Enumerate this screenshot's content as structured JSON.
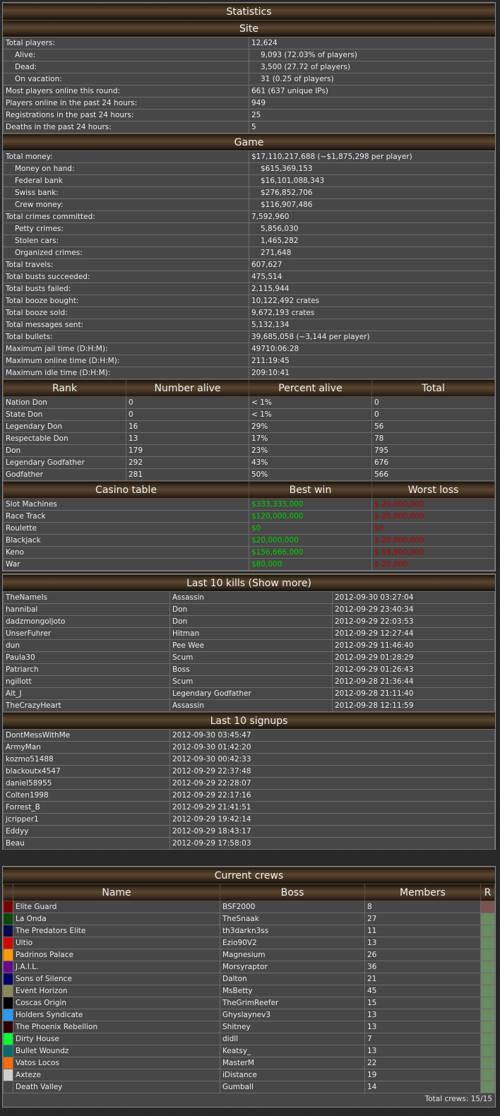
{
  "titles": {
    "statistics": "Statistics",
    "site": "Site",
    "game": "Game",
    "kills": "Last 10 kills (Show more)",
    "signups": "Last 10 signups",
    "crews": "Current crews"
  },
  "site": [
    {
      "label": "Total players:",
      "value": "12,624",
      "indent": false
    },
    {
      "label": "Alive:",
      "value": "9,093 (72.03% of players)",
      "indent": true
    },
    {
      "label": "Dead:",
      "value": "3,500 (27.72 of players)",
      "indent": true
    },
    {
      "label": "On vacation:",
      "value": "31 (0.25 of players)",
      "indent": true
    },
    {
      "label": "Most players online this round:",
      "value": "661 (637 unique IPs)",
      "indent": false
    },
    {
      "label": "Players online in the past 24 hours:",
      "value": "949",
      "indent": false
    },
    {
      "label": "Registrations in the past 24 hours:",
      "value": "25",
      "indent": false
    },
    {
      "label": "Deaths in the past 24 hours:",
      "value": "5",
      "indent": false
    }
  ],
  "game": [
    {
      "label": "Total money:",
      "value": "$17,110,217,688 (~$1,875,298 per player)",
      "indent": false
    },
    {
      "label": "Money on hand:",
      "value": "$615,369,153",
      "indent": true
    },
    {
      "label": "Federal bank",
      "value": "$16,101,088,343",
      "indent": true
    },
    {
      "label": "Swiss bank:",
      "value": "$276,852,706",
      "indent": true
    },
    {
      "label": "Crew money:",
      "value": "$116,907,486",
      "indent": true
    },
    {
      "label": "Total crimes committed:",
      "value": "7,592,960",
      "indent": false
    },
    {
      "label": "Petty crimes:",
      "value": "5,856,030",
      "indent": true
    },
    {
      "label": "Stolen cars:",
      "value": "1,465,282",
      "indent": true
    },
    {
      "label": "Organized crimes:",
      "value": "271,648",
      "indent": true
    },
    {
      "label": "Total travels:",
      "value": "607,627",
      "indent": false
    },
    {
      "label": "Total busts succeeded:",
      "value": "475,514",
      "indent": false
    },
    {
      "label": "Total busts failed:",
      "value": "2,115,944",
      "indent": false
    },
    {
      "label": "Total booze bought:",
      "value": "10,122,492 crates",
      "indent": false
    },
    {
      "label": "Total booze sold:",
      "value": "9,672,193 crates",
      "indent": false
    },
    {
      "label": "Total messages sent:",
      "value": "5,132,134",
      "indent": false
    },
    {
      "label": "Total bullets:",
      "value": "39,685,058 (~3,144 per player)",
      "indent": false
    },
    {
      "label": "Maximum jail time (D:H:M):",
      "value": "49710:06:28",
      "indent": false
    },
    {
      "label": "Maximum online time (D:H:M):",
      "value": "211:19:45",
      "indent": false
    },
    {
      "label": "Maximum idle time (D:H:M):",
      "value": "209:10:41",
      "indent": false
    }
  ],
  "rank_headers": [
    "Rank",
    "Number alive",
    "Percent alive",
    "Total"
  ],
  "ranks": [
    [
      "Nation Don",
      "0",
      "< 1%",
      "0"
    ],
    [
      "State Don",
      "0",
      "< 1%",
      "0"
    ],
    [
      "Legendary Don",
      "16",
      "29%",
      "56"
    ],
    [
      "Respectable Don",
      "13",
      "17%",
      "78"
    ],
    [
      "Don",
      "179",
      "23%",
      "795"
    ],
    [
      "Legendary Godfather",
      "292",
      "43%",
      "676"
    ],
    [
      "Godfather",
      "281",
      "50%",
      "566"
    ]
  ],
  "casino_headers": [
    "Casino table",
    "Best win",
    "Worst loss"
  ],
  "casino": [
    [
      "Slot Machines",
      "$333,333,000",
      "$-20,000,000"
    ],
    [
      "Race Track",
      "$120,000,000",
      "$-35,000,000"
    ],
    [
      "Roulette",
      "$0",
      "$0"
    ],
    [
      "Blackjack",
      "$20,000,000",
      "$-20,000,000"
    ],
    [
      "Keno",
      "$156,666,000",
      "$-18,900,000"
    ],
    [
      "War",
      "$80,000",
      "$-20,000"
    ]
  ],
  "kills": [
    [
      "TheNameIs",
      "Assassin",
      "2012-09-30 03:27:04"
    ],
    [
      "hannibal",
      "Don",
      "2012-09-29 23:40:34"
    ],
    [
      "dadzmongoljoto",
      "Don",
      "2012-09-29 22:03:53"
    ],
    [
      "UnserFuhrer",
      "Hitman",
      "2012-09-29 12:27:44"
    ],
    [
      "dun",
      "Pee Wee",
      "2012-09-29 11:46:40"
    ],
    [
      "Paula30",
      "Scum",
      "2012-09-29 01:28:29"
    ],
    [
      "Patriarch",
      "Boss",
      "2012-09-29 01:26:43"
    ],
    [
      "ngillott",
      "Scum",
      "2012-09-28 21:36:44"
    ],
    [
      "Alt_J",
      "Legendary Godfather",
      "2012-09-28 21:11:40"
    ],
    [
      "TheCrazyHeart",
      "Assassin",
      "2012-09-28 12:11:59"
    ]
  ],
  "signups": [
    [
      "DontMessWithMe",
      "2012-09-30 03:45:47"
    ],
    [
      "ArmyMan",
      "2012-09-30 01:42:20"
    ],
    [
      "kozmo51488",
      "2012-09-30 00:42:33"
    ],
    [
      "blackoutx4547",
      "2012-09-29 22:37:48"
    ],
    [
      "daniel58955",
      "2012-09-29 22:28:07"
    ],
    [
      "Colten1998",
      "2012-09-29 22:17:16"
    ],
    [
      "Forrest_B",
      "2012-09-29 21:41:51"
    ],
    [
      "jcripper1",
      "2012-09-29 19:42:14"
    ],
    [
      "Eddyy",
      "2012-09-29 18:43:17"
    ],
    [
      "Beau",
      "2012-09-29 17:58:03"
    ]
  ],
  "crew_headers": [
    "Name",
    "Boss",
    "Members",
    "R"
  ],
  "crews": [
    {
      "name": "Elite Guard",
      "boss": "BSF2000",
      "members": "8",
      "color": "#7a0000",
      "r": "#7a5252"
    },
    {
      "name": "La Onda",
      "boss": "TheSnaak",
      "members": "27",
      "color": "#0a4a0a",
      "r": "#6a8b64"
    },
    {
      "name": "The Predators Elite",
      "boss": "th3darkn3ss",
      "members": "11",
      "color": "#0a0a4a",
      "r": "#6a8b64"
    },
    {
      "name": "Ultio",
      "boss": "Ezio90V2",
      "members": "13",
      "color": "#d40000",
      "r": "#6a8b64"
    },
    {
      "name": "Padrinos Palace",
      "boss": "Magnesium",
      "members": "26",
      "color": "#ff9900",
      "r": "#6a8b64"
    },
    {
      "name": "J.A.I.L.",
      "boss": "Morsyraptor",
      "members": "36",
      "color": "#6a0a8a",
      "r": "#6a8b64"
    },
    {
      "name": "Sons of Silence",
      "boss": "Dalton",
      "members": "21",
      "color": "#000066",
      "r": "#6a8b64"
    },
    {
      "name": "Event Horizon",
      "boss": "MsBetty",
      "members": "45",
      "color": "#8a8a5a",
      "r": "#6a8b64"
    },
    {
      "name": "Coscas Origin",
      "boss": "TheGrimReefer",
      "members": "15",
      "color": "#000000",
      "r": "#6a8b64"
    },
    {
      "name": "Holders Syndicate",
      "boss": "Ghyslaynev3",
      "members": "13",
      "color": "#2a9aff",
      "r": "#6a8b64"
    },
    {
      "name": "The Phoenix Rebellion",
      "boss": "Shitney",
      "members": "13",
      "color": "#2a0000",
      "r": "#6a8b64"
    },
    {
      "name": "Dirty House",
      "boss": "didll",
      "members": "7",
      "color": "#00ff33",
      "r": "#6a8b64"
    },
    {
      "name": "Bullet Woundz",
      "boss": "Keatsy_",
      "members": "13",
      "color": "#0a6a6a",
      "r": "#6a8b64"
    },
    {
      "name": "Vatos Locos",
      "boss": "MasterM",
      "members": "22",
      "color": "#ff6a0a",
      "r": "#6a8b64"
    },
    {
      "name": "Axteze",
      "boss": "iDistance",
      "members": "19",
      "color": "#cfcfcf",
      "r": "#6a8b64"
    },
    {
      "name": "Death Valley",
      "boss": "Gumball",
      "members": "14",
      "color": "#474747",
      "r": "#6a8b64"
    }
  ],
  "crew_total": "Total crews: 15/15"
}
